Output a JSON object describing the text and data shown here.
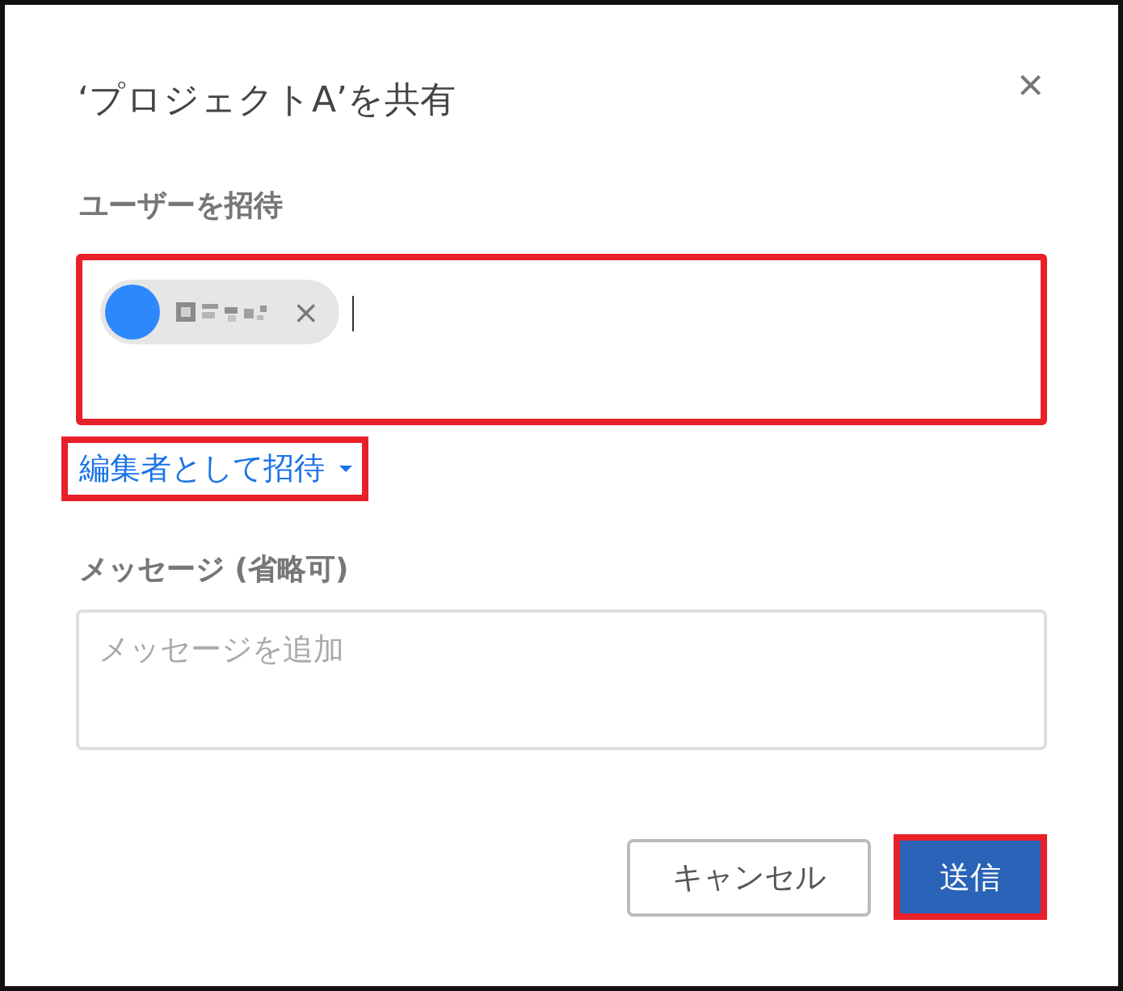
{
  "dialog": {
    "title": "‘プロジェクトA’を共有",
    "close": "×"
  },
  "invite": {
    "label": "ユーザーを招待",
    "highlighted": true,
    "chips": [
      {
        "color": "#2d89fb",
        "name_redacted": true,
        "remove": "×"
      }
    ]
  },
  "role_link": {
    "label": "編集者として招待",
    "highlighted": true
  },
  "message": {
    "label": "メッセージ (省略可)",
    "placeholder": "メッセージを追加"
  },
  "buttons": [
    {
      "label": "キャンセル",
      "kind": "secondary",
      "highlighted": false
    },
    {
      "label": "送信",
      "kind": "primary",
      "highlighted": true
    }
  ]
}
